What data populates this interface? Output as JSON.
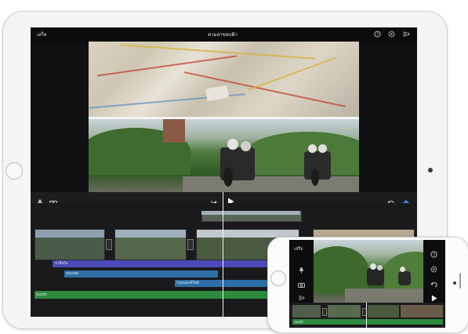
{
  "ipad": {
    "done_label": "เสร็จ",
    "project_title": "ตามล่าขอบฟ้า",
    "icons": [
      "help-icon",
      "settings-icon",
      "project-settings-icon",
      "microphone-icon",
      "camera-icon",
      "skip-back-icon",
      "play-icon",
      "undo-icon",
      "effects-icon"
    ]
  },
  "timeline": {
    "title_clip_label": "ปาลินโย",
    "audio_label_1": "ขอบเขต",
    "audio_label_2": "รถมอเตอร์ไซค์",
    "music_label": "ขอบฟ้า"
  },
  "iphone": {
    "done_label": "เสร็จ",
    "music_label": "ขอบฟ้า"
  },
  "colors": {
    "title_track": "#4b4ab8",
    "audio_track": "#2e6fa8",
    "music_track": "#2d8a3e",
    "accent": "#3b8cf0"
  }
}
